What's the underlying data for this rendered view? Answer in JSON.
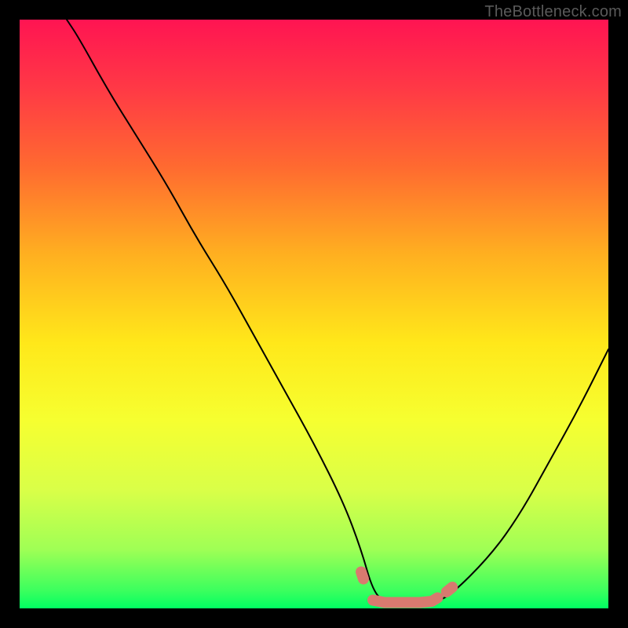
{
  "watermark": "TheBottleneck.com",
  "chart_data": {
    "type": "line",
    "title": "",
    "xlabel": "",
    "ylabel": "",
    "xlim": [
      0,
      100
    ],
    "ylim": [
      0,
      100
    ],
    "series": [
      {
        "name": "bottleneck-curve",
        "x": [
          8,
          10,
          15,
          20,
          25,
          30,
          35,
          40,
          45,
          50,
          55,
          58,
          60,
          62,
          65,
          68,
          70,
          73,
          80,
          85,
          90,
          95,
          100
        ],
        "values": [
          100,
          97,
          88,
          80,
          72,
          63,
          55,
          46,
          37,
          28,
          18,
          10,
          3,
          1,
          1,
          1,
          1,
          2,
          9,
          16,
          25,
          34,
          44
        ]
      }
    ],
    "overlay": {
      "name": "highlight-band",
      "color": "#d87a6f",
      "segments": [
        {
          "x": [
            58,
            58.4
          ],
          "values": [
            6.2,
            5.0
          ]
        },
        {
          "x": [
            60,
            62,
            65,
            68,
            70,
            71
          ],
          "values": [
            1.4,
            1.0,
            1.0,
            1.0,
            1.2,
            1.8
          ]
        },
        {
          "x": [
            72.5,
            73.5
          ],
          "values": [
            2.8,
            3.6
          ]
        }
      ]
    },
    "grid": false,
    "legend": false
  }
}
